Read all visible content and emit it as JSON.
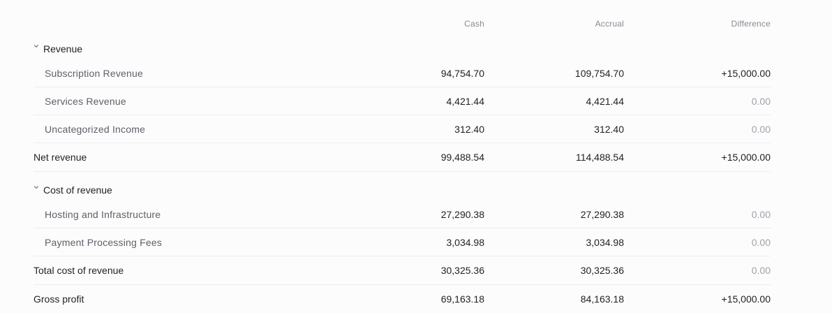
{
  "columns": {
    "cash": "Cash",
    "accrual": "Accrual",
    "difference": "Difference"
  },
  "sections": {
    "revenue": {
      "title": "Revenue",
      "items": [
        {
          "label": "Subscription Revenue",
          "cash": "94,754.70",
          "accrual": "109,754.70",
          "difference": "+15,000.00"
        },
        {
          "label": "Services Revenue",
          "cash": "4,421.44",
          "accrual": "4,421.44",
          "difference": "0.00"
        },
        {
          "label": "Uncategorized Income",
          "cash": "312.40",
          "accrual": "312.40",
          "difference": "0.00"
        }
      ],
      "total": {
        "label": "Net revenue",
        "cash": "99,488.54",
        "accrual": "114,488.54",
        "difference": "+15,000.00"
      }
    },
    "cost_of_revenue": {
      "title": "Cost of revenue",
      "items": [
        {
          "label": "Hosting and Infrastructure",
          "cash": "27,290.38",
          "accrual": "27,290.38",
          "difference": "0.00"
        },
        {
          "label": "Payment Processing Fees",
          "cash": "3,034.98",
          "accrual": "3,034.98",
          "difference": "0.00"
        }
      ],
      "total": {
        "label": "Total cost of revenue",
        "cash": "30,325.36",
        "accrual": "30,325.36",
        "difference": "0.00"
      }
    }
  },
  "gross_profit": {
    "label": "Gross profit",
    "cash": "69,163.18",
    "accrual": "84,163.18",
    "difference": "+15,000.00"
  },
  "icons": {
    "section_toggle": "chevron-down-icon"
  }
}
